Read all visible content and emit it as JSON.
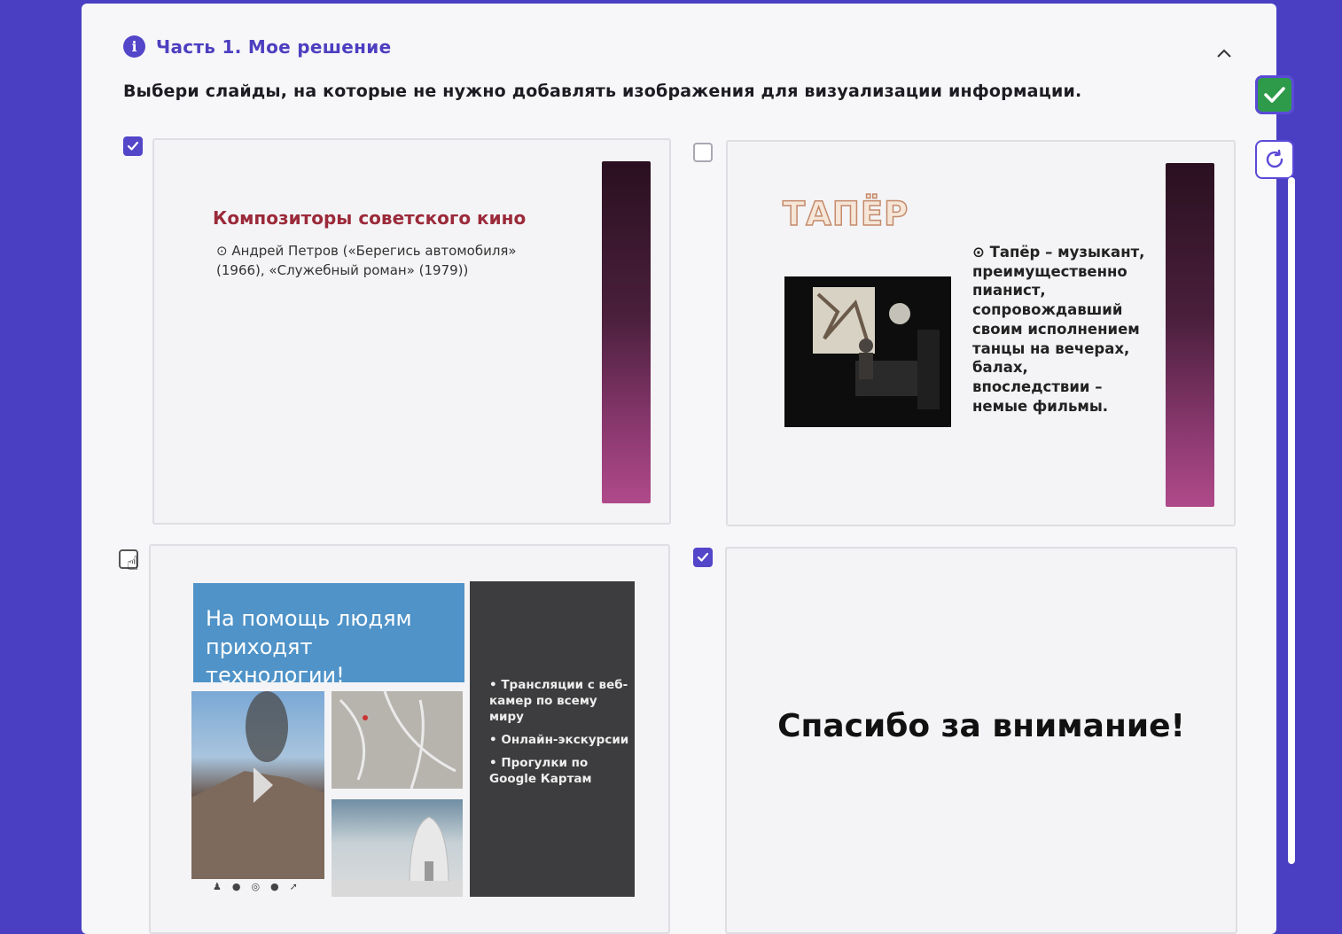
{
  "header": {
    "title": "Часть 1. Мое решение"
  },
  "instruction": "Выбери слайды, на которые не нужно добавлять изображения для визуализации информации.",
  "colors": {
    "accent": "#5346c9",
    "success": "#2e9b4b",
    "page_bg": "#4a3fc2"
  },
  "icons": {
    "info": "info-icon",
    "collapse": "chevron-up-icon",
    "submit": "check-icon",
    "reset": "refresh-icon",
    "pointer": "hand-pointer-icon"
  },
  "options": [
    {
      "checked": true,
      "slide": {
        "title": "Композиторы советского кино",
        "bullet": "Андрей Петров («Берегись автомобиля» (1966), «Служебный роман» (1979))"
      }
    },
    {
      "checked": false,
      "slide": {
        "title": "ТАПЁР",
        "bullet": "Тапёр – музыкант, преимущественно пианист, сопровождавший своим исполнением танцы на вечерах, балах, впоследствии – немые фильмы."
      }
    },
    {
      "checked": false,
      "slide": {
        "title": "На помощь людям приходят технологии!",
        "bullets": [
          "Трансляции с веб-камер по всему миру",
          "Онлайн-экскурсии",
          "Прогулки по Google Картам"
        ]
      }
    },
    {
      "checked": true,
      "slide": {
        "text": "Спасибо за внимание!"
      }
    }
  ]
}
